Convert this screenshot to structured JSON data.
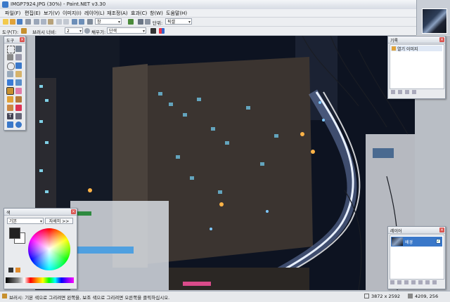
{
  "window": {
    "title": "IMGP7924.JPG (30%) - Paint.NET v3.30"
  },
  "menu": [
    "파일(F)",
    "편집(E)",
    "보기(V)",
    "이미지(I)",
    "레이어(L)",
    "재조정(A)",
    "효과(C)",
    "창(W)",
    "도움말(H)"
  ],
  "toolbar1": {
    "zoom_value": "창",
    "units_label": "단위:",
    "units_value": "픽셀"
  },
  "toolbar2": {
    "tool_label": "도구(T):",
    "brush_width_label": "브러시 너비:",
    "brush_width_value": "2",
    "fill_label": "채우기:",
    "fill_value": "단색"
  },
  "tools_panel": {
    "title": "도구"
  },
  "history_panel": {
    "title": "기록",
    "items": [
      "열기 이미지"
    ]
  },
  "colors_panel": {
    "title": "색",
    "mode": "기본",
    "more_label": "자세히 >>"
  },
  "layers_panel": {
    "title": "레이어",
    "layers": [
      {
        "name": "배경"
      }
    ]
  },
  "status": {
    "hint": "브러시: 기본 색으로 그리려면 왼쪽을, 보조 색으로 그리려면 오른쪽을 클릭하십시오.",
    "image_size": "3872 x 2592",
    "cursor_pos": "4209, 256"
  },
  "colors": {
    "primary": "#222222",
    "secondary": "#ffffff",
    "accent": "#3a78c9"
  }
}
